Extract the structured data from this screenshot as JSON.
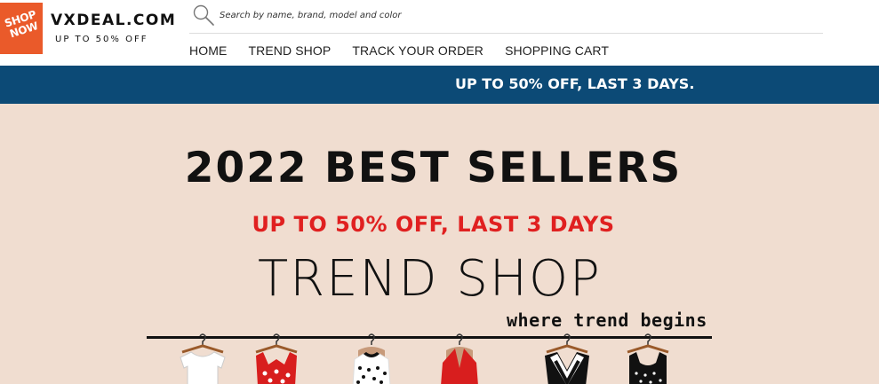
{
  "logo": {
    "badge_text": "SHOP NOW",
    "name": "VXDEAL.COM",
    "tagline": "UP TO 50% OFF",
    "badge_color": "#ea5a2a"
  },
  "search": {
    "placeholder": "Search by name, brand, model and color",
    "value": "",
    "icon": "search-icon"
  },
  "nav": {
    "items": [
      {
        "label": "HOME"
      },
      {
        "label": "TREND SHOP"
      },
      {
        "label": "TRACK YOUR ORDER"
      },
      {
        "label": "SHOPPING CART"
      }
    ]
  },
  "promo_bar": {
    "text": "UP TO 50% OFF, LAST 3 DAYS.",
    "background": "#0c4a76"
  },
  "banner": {
    "headline": "2022 BEST SELLERS",
    "subheadline": "UP TO 50% OFF, LAST 3 DAYS",
    "brand": "TREND SHOP",
    "slogan": "where trend begins",
    "background": "#f0ddd0",
    "accent_color": "#e02020",
    "garments": [
      "white-top",
      "red-polka-top",
      "white-polka-dress",
      "red-halter-top",
      "black-white-top",
      "black-polka-top"
    ]
  }
}
